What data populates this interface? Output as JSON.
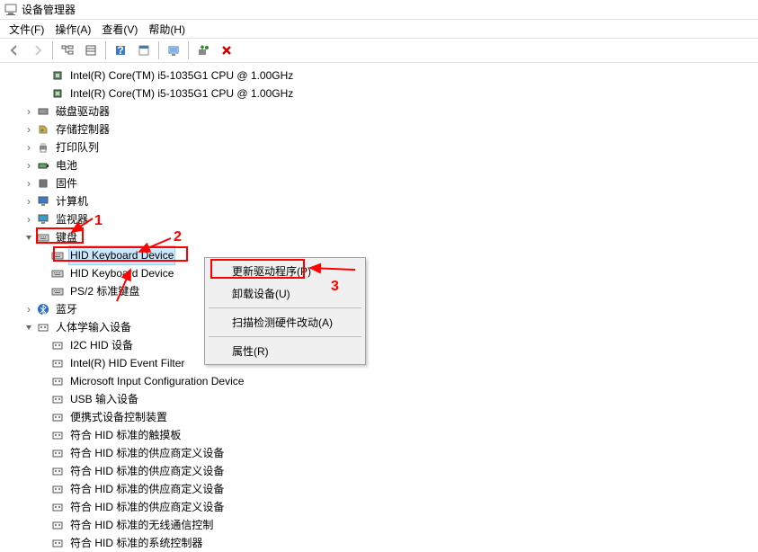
{
  "window": {
    "title": "设备管理器"
  },
  "menu": {
    "file": "文件(F)",
    "action": "操作(A)",
    "view": "查看(V)",
    "help": "帮助(H)"
  },
  "tree": {
    "cpu1": "Intel(R) Core(TM) i5-1035G1 CPU @ 1.00GHz",
    "cpu2": "Intel(R) Core(TM) i5-1035G1 CPU @ 1.00GHz",
    "disk": "磁盘驱动器",
    "storage": "存储控制器",
    "print": "打印队列",
    "battery": "电池",
    "firmware": "固件",
    "computer": "计算机",
    "monitor": "监视器",
    "keyboard": "键盘",
    "kb_hid1": "HID Keyboard Device",
    "kb_hid2": "HID Keyboard Device",
    "kb_ps2": "PS/2 标准键盘",
    "bluetooth": "蓝牙",
    "hid": "人体学输入设备",
    "hid_i2c": "I2C HID 设备",
    "hid_intel": "Intel(R) HID Event Filter",
    "hid_ms": "Microsoft Input Configuration Device",
    "hid_usb": "USB 输入设备",
    "hid_port": "便携式设备控制装置",
    "hid_touch": "符合 HID 标准的触摸板",
    "hid_v1": "符合 HID 标准的供应商定义设备",
    "hid_v2": "符合 HID 标准的供应商定义设备",
    "hid_v3": "符合 HID 标准的供应商定义设备",
    "hid_v4": "符合 HID 标准的供应商定义设备",
    "hid_wl": "符合 HID 标准的无线通信控制",
    "hid_sys": "符合 HID 标准的系统控制器"
  },
  "context": {
    "update": "更新驱动程序(P)",
    "uninstall": "卸载设备(U)",
    "scan": "扫描检测硬件改动(A)",
    "props": "属性(R)"
  },
  "annotations": {
    "n1": "1",
    "n2": "2",
    "n3": "3"
  }
}
